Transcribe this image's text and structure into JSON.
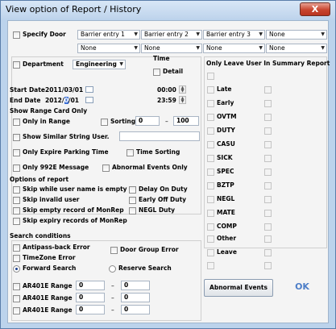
{
  "window": {
    "title": "View option of Report / History"
  },
  "doors": {
    "specify_label": "Specify Door",
    "row1": [
      "Barrier entry 1",
      "Barrier entry 2",
      "Barrier entry 3",
      "None"
    ],
    "row2": [
      "None",
      "None",
      "None",
      "None"
    ]
  },
  "department": {
    "label": "Department",
    "value": "Engineering"
  },
  "time": {
    "label": "Time",
    "detail_label": "Detail"
  },
  "dates": {
    "start_label": "Start Date",
    "start_value": "2011/03/01",
    "start_time": "00:00",
    "end_label": "End Date",
    "end_value_pre": "2012/",
    "end_value_sel": "0",
    "end_value_post": "/01",
    "end_time": "23:59"
  },
  "range_card": {
    "label": "Show Range Card Only",
    "only_in_range": "Only in Range",
    "sorting": "Sorting",
    "from": "0",
    "dash": "–",
    "to": "100"
  },
  "similar": {
    "label": "Show Similar String User.",
    "value": ""
  },
  "expire": {
    "only_expire": "Only Expire Parking Time",
    "time_sorting": "Time Sorting"
  },
  "message": {
    "only_992e": "Only 992E Message",
    "abnormal_only": "Abnormal Events Only"
  },
  "options": {
    "heading": "Options of report",
    "skip_empty_name": "Skip while user name is empty",
    "delay_on_duty": "Delay On Duty",
    "skip_invalid": "Skip invalid user",
    "early_off_duty": "Early Off Duty",
    "skip_empty_monrep": "Skip empty record of MonRep",
    "negl_duty": "NEGL Duty",
    "skip_expiry": "Skip expiry records of MonRep"
  },
  "search": {
    "heading": "Search conditions",
    "antipass": "Antipass-back Error",
    "door_group": "Door Group Error",
    "timezone": "TimeZone Error",
    "forward": "Forward Search",
    "reserve": "Reserve Search"
  },
  "ar_ranges": [
    {
      "label": "AR401E Range",
      "from": "0",
      "dash": "–",
      "to": "0"
    },
    {
      "label": "AR401E Range",
      "from": "0",
      "dash": "–",
      "to": "0"
    },
    {
      "label": "AR401E Range",
      "from": "0",
      "dash": "–",
      "to": "0"
    }
  ],
  "summary": {
    "heading": "Only Leave User In Summary Report",
    "items": [
      "Late",
      "Early",
      "OVTM",
      "DUTY",
      "CASU",
      "SICK",
      "SPEC",
      "BZTP",
      "NEGL",
      "MATE",
      "COMP",
      "Other",
      "Leave"
    ]
  },
  "buttons": {
    "abnormal": "Abnormal Events",
    "ok": "OK",
    "close": "X"
  }
}
